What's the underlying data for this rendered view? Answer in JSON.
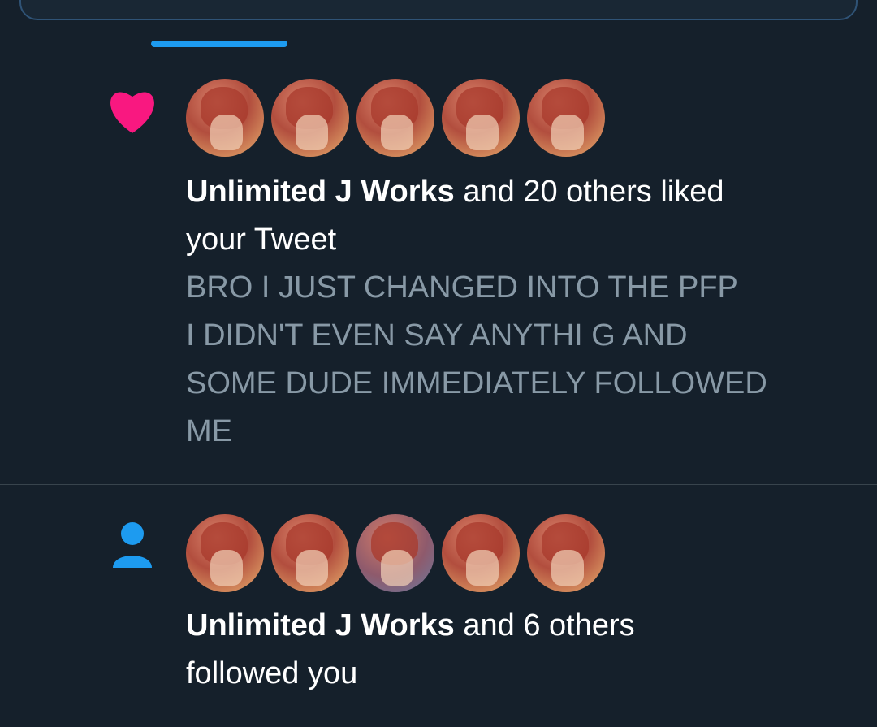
{
  "notifications": [
    {
      "type_icon": "heart-icon",
      "icon_color": "#f91880",
      "actor": "Unlimited J Works",
      "action_line1": " and 20 others liked",
      "action_line2": "your Tweet",
      "tweet_lines": [
        "BRO I JUST CHANGED INTO THE PFP",
        "I DIDN'T EVEN SAY ANYTHI G AND",
        "SOME DUDE IMMEDIATELY FOLLOWED",
        "ME"
      ]
    },
    {
      "type_icon": "person-icon",
      "icon_color": "#1d9bf0",
      "actor": "Unlimited J Works",
      "action_line1": " and 6 others",
      "action_line2": "followed you"
    }
  ],
  "colors": {
    "background": "#15202b",
    "divider": "#38444d",
    "tab_indicator": "#1d9bf0",
    "secondary_text": "#8899a6"
  }
}
